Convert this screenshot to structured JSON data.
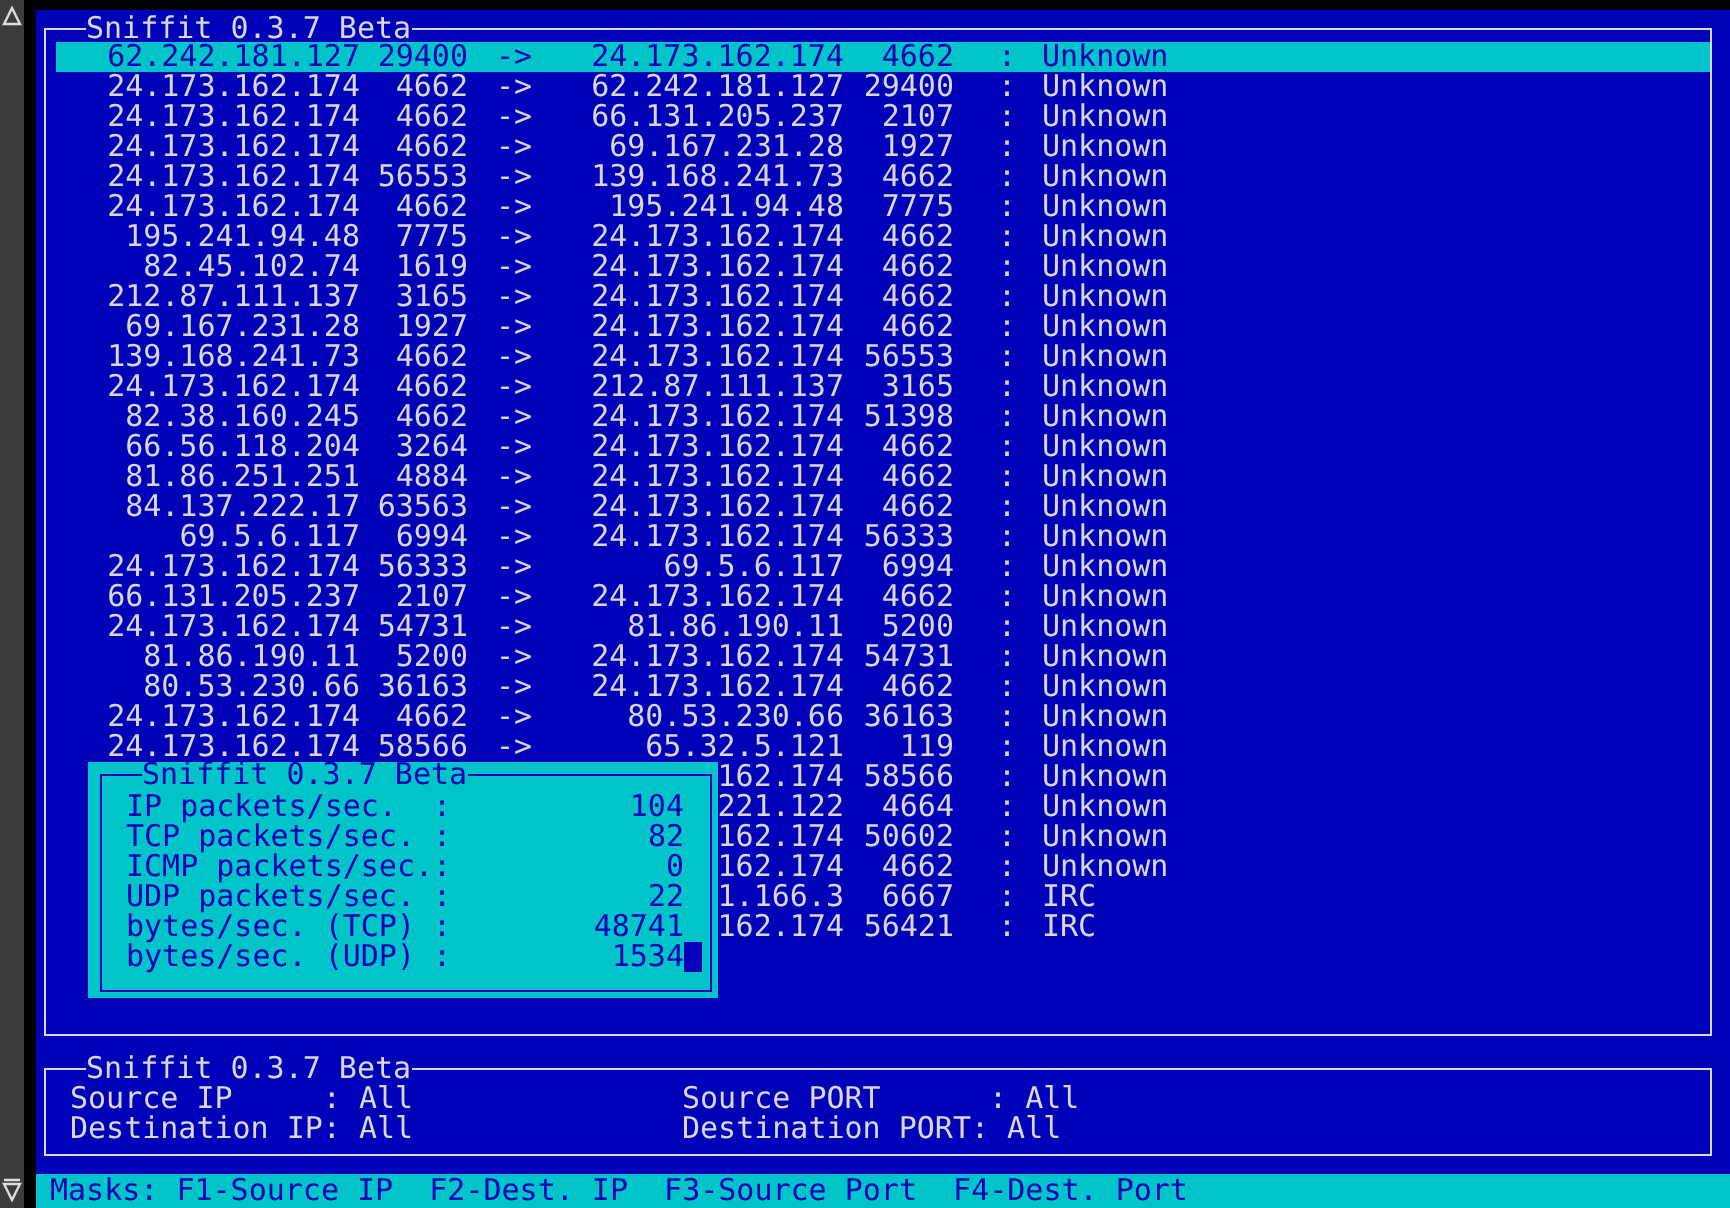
{
  "connections_panel": {
    "title": "Sniffit 0.3.7 Beta",
    "rows": [
      {
        "src": "62.242.181.127",
        "sport": "29400",
        "arrow": "->",
        "dst": "24.173.162.174",
        "dport": "4662",
        "sep": ":",
        "proto": "Unknown",
        "selected": true
      },
      {
        "src": "24.173.162.174",
        "sport": "4662",
        "arrow": "->",
        "dst": "62.242.181.127",
        "dport": "29400",
        "sep": ":",
        "proto": "Unknown",
        "selected": false
      },
      {
        "src": "24.173.162.174",
        "sport": "4662",
        "arrow": "->",
        "dst": "66.131.205.237",
        "dport": "2107",
        "sep": ":",
        "proto": "Unknown",
        "selected": false
      },
      {
        "src": "24.173.162.174",
        "sport": "4662",
        "arrow": "->",
        "dst": "69.167.231.28",
        "dport": "1927",
        "sep": ":",
        "proto": "Unknown",
        "selected": false
      },
      {
        "src": "24.173.162.174",
        "sport": "56553",
        "arrow": "->",
        "dst": "139.168.241.73",
        "dport": "4662",
        "sep": ":",
        "proto": "Unknown",
        "selected": false
      },
      {
        "src": "24.173.162.174",
        "sport": "4662",
        "arrow": "->",
        "dst": "195.241.94.48",
        "dport": "7775",
        "sep": ":",
        "proto": "Unknown",
        "selected": false
      },
      {
        "src": "195.241.94.48",
        "sport": "7775",
        "arrow": "->",
        "dst": "24.173.162.174",
        "dport": "4662",
        "sep": ":",
        "proto": "Unknown",
        "selected": false
      },
      {
        "src": "82.45.102.74",
        "sport": "1619",
        "arrow": "->",
        "dst": "24.173.162.174",
        "dport": "4662",
        "sep": ":",
        "proto": "Unknown",
        "selected": false
      },
      {
        "src": "212.87.111.137",
        "sport": "3165",
        "arrow": "->",
        "dst": "24.173.162.174",
        "dport": "4662",
        "sep": ":",
        "proto": "Unknown",
        "selected": false
      },
      {
        "src": "69.167.231.28",
        "sport": "1927",
        "arrow": "->",
        "dst": "24.173.162.174",
        "dport": "4662",
        "sep": ":",
        "proto": "Unknown",
        "selected": false
      },
      {
        "src": "139.168.241.73",
        "sport": "4662",
        "arrow": "->",
        "dst": "24.173.162.174",
        "dport": "56553",
        "sep": ":",
        "proto": "Unknown",
        "selected": false
      },
      {
        "src": "24.173.162.174",
        "sport": "4662",
        "arrow": "->",
        "dst": "212.87.111.137",
        "dport": "3165",
        "sep": ":",
        "proto": "Unknown",
        "selected": false
      },
      {
        "src": "82.38.160.245",
        "sport": "4662",
        "arrow": "->",
        "dst": "24.173.162.174",
        "dport": "51398",
        "sep": ":",
        "proto": "Unknown",
        "selected": false
      },
      {
        "src": "66.56.118.204",
        "sport": "3264",
        "arrow": "->",
        "dst": "24.173.162.174",
        "dport": "4662",
        "sep": ":",
        "proto": "Unknown",
        "selected": false
      },
      {
        "src": "81.86.251.251",
        "sport": "4884",
        "arrow": "->",
        "dst": "24.173.162.174",
        "dport": "4662",
        "sep": ":",
        "proto": "Unknown",
        "selected": false
      },
      {
        "src": "84.137.222.17",
        "sport": "63563",
        "arrow": "->",
        "dst": "24.173.162.174",
        "dport": "4662",
        "sep": ":",
        "proto": "Unknown",
        "selected": false
      },
      {
        "src": "69.5.6.117",
        "sport": "6994",
        "arrow": "->",
        "dst": "24.173.162.174",
        "dport": "56333",
        "sep": ":",
        "proto": "Unknown",
        "selected": false
      },
      {
        "src": "24.173.162.174",
        "sport": "56333",
        "arrow": "->",
        "dst": "69.5.6.117",
        "dport": "6994",
        "sep": ":",
        "proto": "Unknown",
        "selected": false
      },
      {
        "src": "66.131.205.237",
        "sport": "2107",
        "arrow": "->",
        "dst": "24.173.162.174",
        "dport": "4662",
        "sep": ":",
        "proto": "Unknown",
        "selected": false
      },
      {
        "src": "24.173.162.174",
        "sport": "54731",
        "arrow": "->",
        "dst": "81.86.190.11",
        "dport": "5200",
        "sep": ":",
        "proto": "Unknown",
        "selected": false
      },
      {
        "src": "81.86.190.11",
        "sport": "5200",
        "arrow": "->",
        "dst": "24.173.162.174",
        "dport": "54731",
        "sep": ":",
        "proto": "Unknown",
        "selected": false
      },
      {
        "src": "80.53.230.66",
        "sport": "36163",
        "arrow": "->",
        "dst": "24.173.162.174",
        "dport": "4662",
        "sep": ":",
        "proto": "Unknown",
        "selected": false
      },
      {
        "src": "24.173.162.174",
        "sport": "4662",
        "arrow": "->",
        "dst": "80.53.230.66",
        "dport": "36163",
        "sep": ":",
        "proto": "Unknown",
        "selected": false
      },
      {
        "src": "24.173.162.174",
        "sport": "58566",
        "arrow": "->",
        "dst": "65.32.5.121",
        "dport": "119",
        "sep": ":",
        "proto": "Unknown",
        "selected": false
      },
      {
        "dst": "162.174",
        "dport": "58566",
        "sep": ":",
        "proto": "Unknown",
        "selected": false
      },
      {
        "dst": "221.122",
        "dport": "4664",
        "sep": ":",
        "proto": "Unknown",
        "selected": false
      },
      {
        "dst": "162.174",
        "dport": "50602",
        "sep": ":",
        "proto": "Unknown",
        "selected": false
      },
      {
        "dst": "162.174",
        "dport": "4662",
        "sep": ":",
        "proto": "Unknown",
        "selected": false
      },
      {
        "dst": "1.166.3",
        "dport": "6667",
        "sep": ":",
        "proto": "IRC",
        "selected": false
      },
      {
        "dst": "162.174",
        "dport": "56421",
        "sep": ":",
        "proto": "IRC",
        "selected": false
      }
    ]
  },
  "stats_popup": {
    "title": "Sniffit 0.3.7 Beta",
    "lines": [
      {
        "label": "IP packets/sec.  :",
        "value": "104"
      },
      {
        "label": "TCP packets/sec. :",
        "value": "82"
      },
      {
        "label": "ICMP packets/sec.:",
        "value": "0"
      },
      {
        "label": "UDP packets/sec. :",
        "value": "22"
      },
      {
        "label": "bytes/sec. (TCP) :",
        "value": "48741"
      },
      {
        "label": "bytes/sec. (UDP) :",
        "value": "1534"
      }
    ]
  },
  "masks_panel": {
    "title": "Sniffit 0.3.7 Beta",
    "filters": [
      {
        "text": "Source IP     : All"
      },
      {
        "text": "Source PORT      : All"
      },
      {
        "text": "Destination IP: All"
      },
      {
        "text": "Destination PORT: All"
      }
    ]
  },
  "status_bar": {
    "text": "Masks: F1-Source IP  F2-Dest. IP  F3-Source Port  F4-Dest. Port"
  }
}
